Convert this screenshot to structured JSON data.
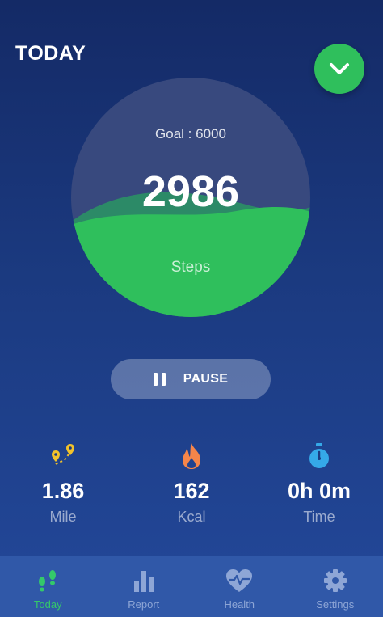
{
  "header": {
    "title": "TODAY"
  },
  "progress": {
    "goal_text": "Goal : 6000",
    "steps": "2986",
    "steps_label": "Steps",
    "fraction": 0.4977
  },
  "control": {
    "pause_label": "PAUSE"
  },
  "stats": [
    {
      "icon": "route-icon",
      "value": "1.86",
      "unit": "Mile"
    },
    {
      "icon": "flame-icon",
      "value": "162",
      "unit": "Kcal"
    },
    {
      "icon": "stopwatch-icon",
      "value": "0h 0m",
      "unit": "Time"
    }
  ],
  "tabs": [
    {
      "icon": "footsteps-icon",
      "label": "Today",
      "active": true
    },
    {
      "icon": "bar-chart-icon",
      "label": "Report",
      "active": false
    },
    {
      "icon": "heart-pulse-icon",
      "label": "Health",
      "active": false
    },
    {
      "icon": "gear-icon",
      "label": "Settings",
      "active": false
    }
  ],
  "colors": {
    "accent_green": "#2fbf5c",
    "tab_active": "#34c96a",
    "tab_inactive": "#8ea6d6",
    "route_icon": "#f2c22b",
    "flame_icon": "#f5854a",
    "stopwatch_icon": "#35a9e8"
  }
}
